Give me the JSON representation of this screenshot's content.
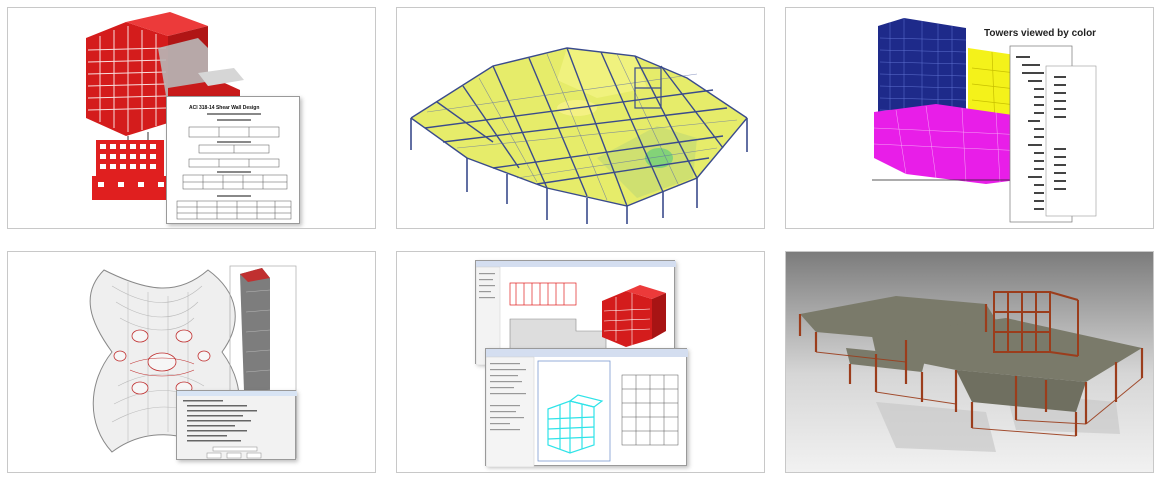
{
  "gallery": {
    "tiles": [
      {
        "id": "shear-wall-design",
        "caption": "",
        "doc_title": "ACI 318-14 Shear Wall Design"
      },
      {
        "id": "floor-deflection",
        "caption": ""
      },
      {
        "id": "towers-by-color",
        "caption": "Towers viewed by color"
      },
      {
        "id": "tower-plan",
        "caption": ""
      },
      {
        "id": "revit-integration",
        "caption": ""
      },
      {
        "id": "rendered-steel",
        "caption": ""
      }
    ]
  },
  "colors": {
    "tile_border": "#c8c8c8",
    "concrete_red": "#e01f1f",
    "navy_tower": "#1e2a8a",
    "yellow_tower": "#f4f21a",
    "magenta_podium": "#e81ee8",
    "steel_blue": "#3a4b8c",
    "deck_yellow": "#e8ee7a",
    "cyan_model": "#2fe3e8",
    "rust_steel": "#9b3d1c",
    "slab_gray": "#7a7a6a"
  }
}
